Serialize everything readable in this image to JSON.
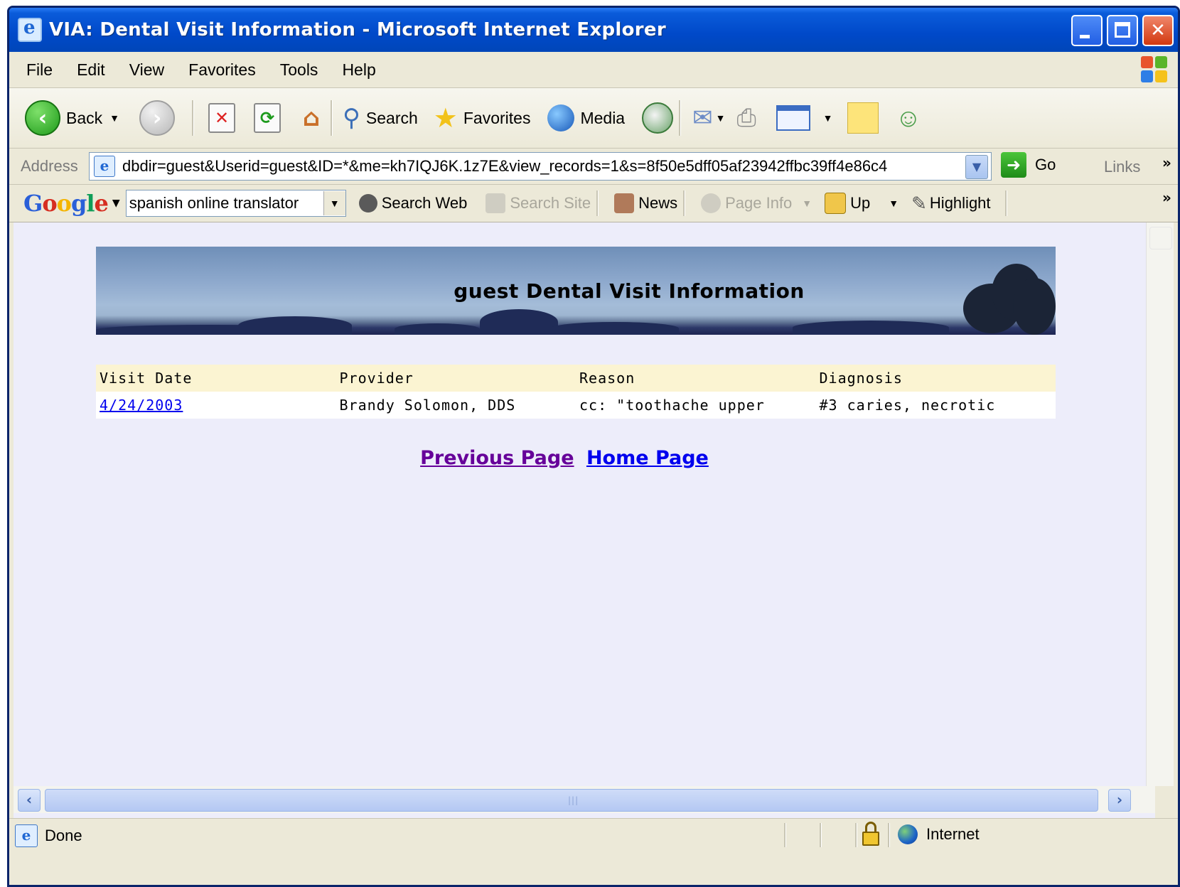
{
  "window": {
    "title": "VIA: Dental Visit Information - Microsoft Internet Explorer"
  },
  "menu": [
    "File",
    "Edit",
    "View",
    "Favorites",
    "Tools",
    "Help"
  ],
  "toolbar": {
    "back": "Back",
    "search": "Search",
    "favorites": "Favorites",
    "media": "Media"
  },
  "address": {
    "label": "Address",
    "url": "dbdir=guest&Userid=guest&ID=*&me=kh7IQJ6K.1z7E&view_records=1&s=8f50e5dff05af23942ffbc39ff4e86c4",
    "go": "Go",
    "links": "Links"
  },
  "google": {
    "search_value": "spanish online translator",
    "search_web": "Search Web",
    "search_site": "Search Site",
    "news": "News",
    "page_info": "Page Info",
    "up": "Up",
    "highlight": "Highlight"
  },
  "page": {
    "banner_title": "guest Dental Visit Information",
    "columns": [
      "Visit Date",
      "Provider",
      "Reason",
      "Diagnosis"
    ],
    "rows": [
      {
        "date": "4/24/2003",
        "provider": "Brandy Solomon, DDS",
        "reason": "cc: \"toothache upper",
        "diagnosis": "#3 caries, necrotic"
      }
    ],
    "previous_page": "Previous Page",
    "home_page": "Home Page"
  },
  "status": {
    "text": "Done",
    "zone": "Internet"
  },
  "colors": {
    "titlebar": "#0049C9",
    "content_bg": "#EDEDFA",
    "table_header_bg": "#FBF4D2",
    "link": "#0000EE",
    "visited_link": "#660099"
  }
}
